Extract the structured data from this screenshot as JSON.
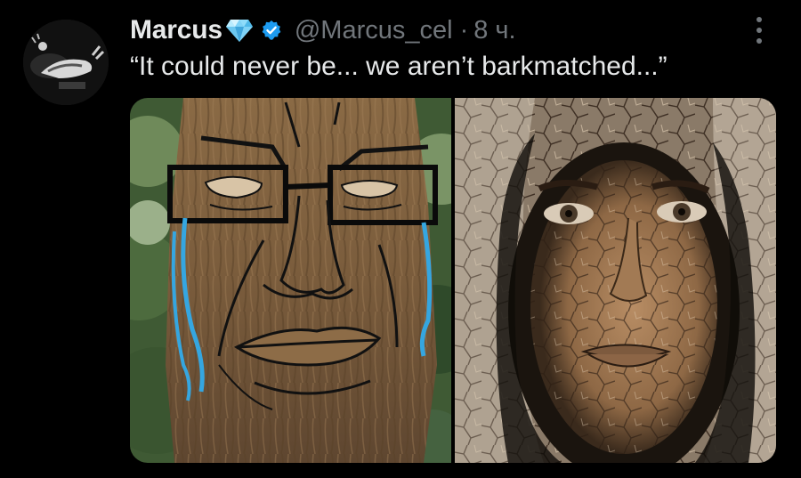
{
  "post": {
    "display_name": "Marcus",
    "handle": "@Marcus_cel",
    "separator": "·",
    "timestamp": "8 ч.",
    "text": "“It could never be... we aren’t barkmatched...”"
  },
  "icons": {
    "badge": "diamond-emoji-icon",
    "verified": "verified-badge-icon",
    "more": "more-options-icon"
  },
  "colors": {
    "background": "#000000",
    "primary_text": "#e7e9ea",
    "secondary_text": "#71767b",
    "verified_blue": "#1d9bf0"
  }
}
